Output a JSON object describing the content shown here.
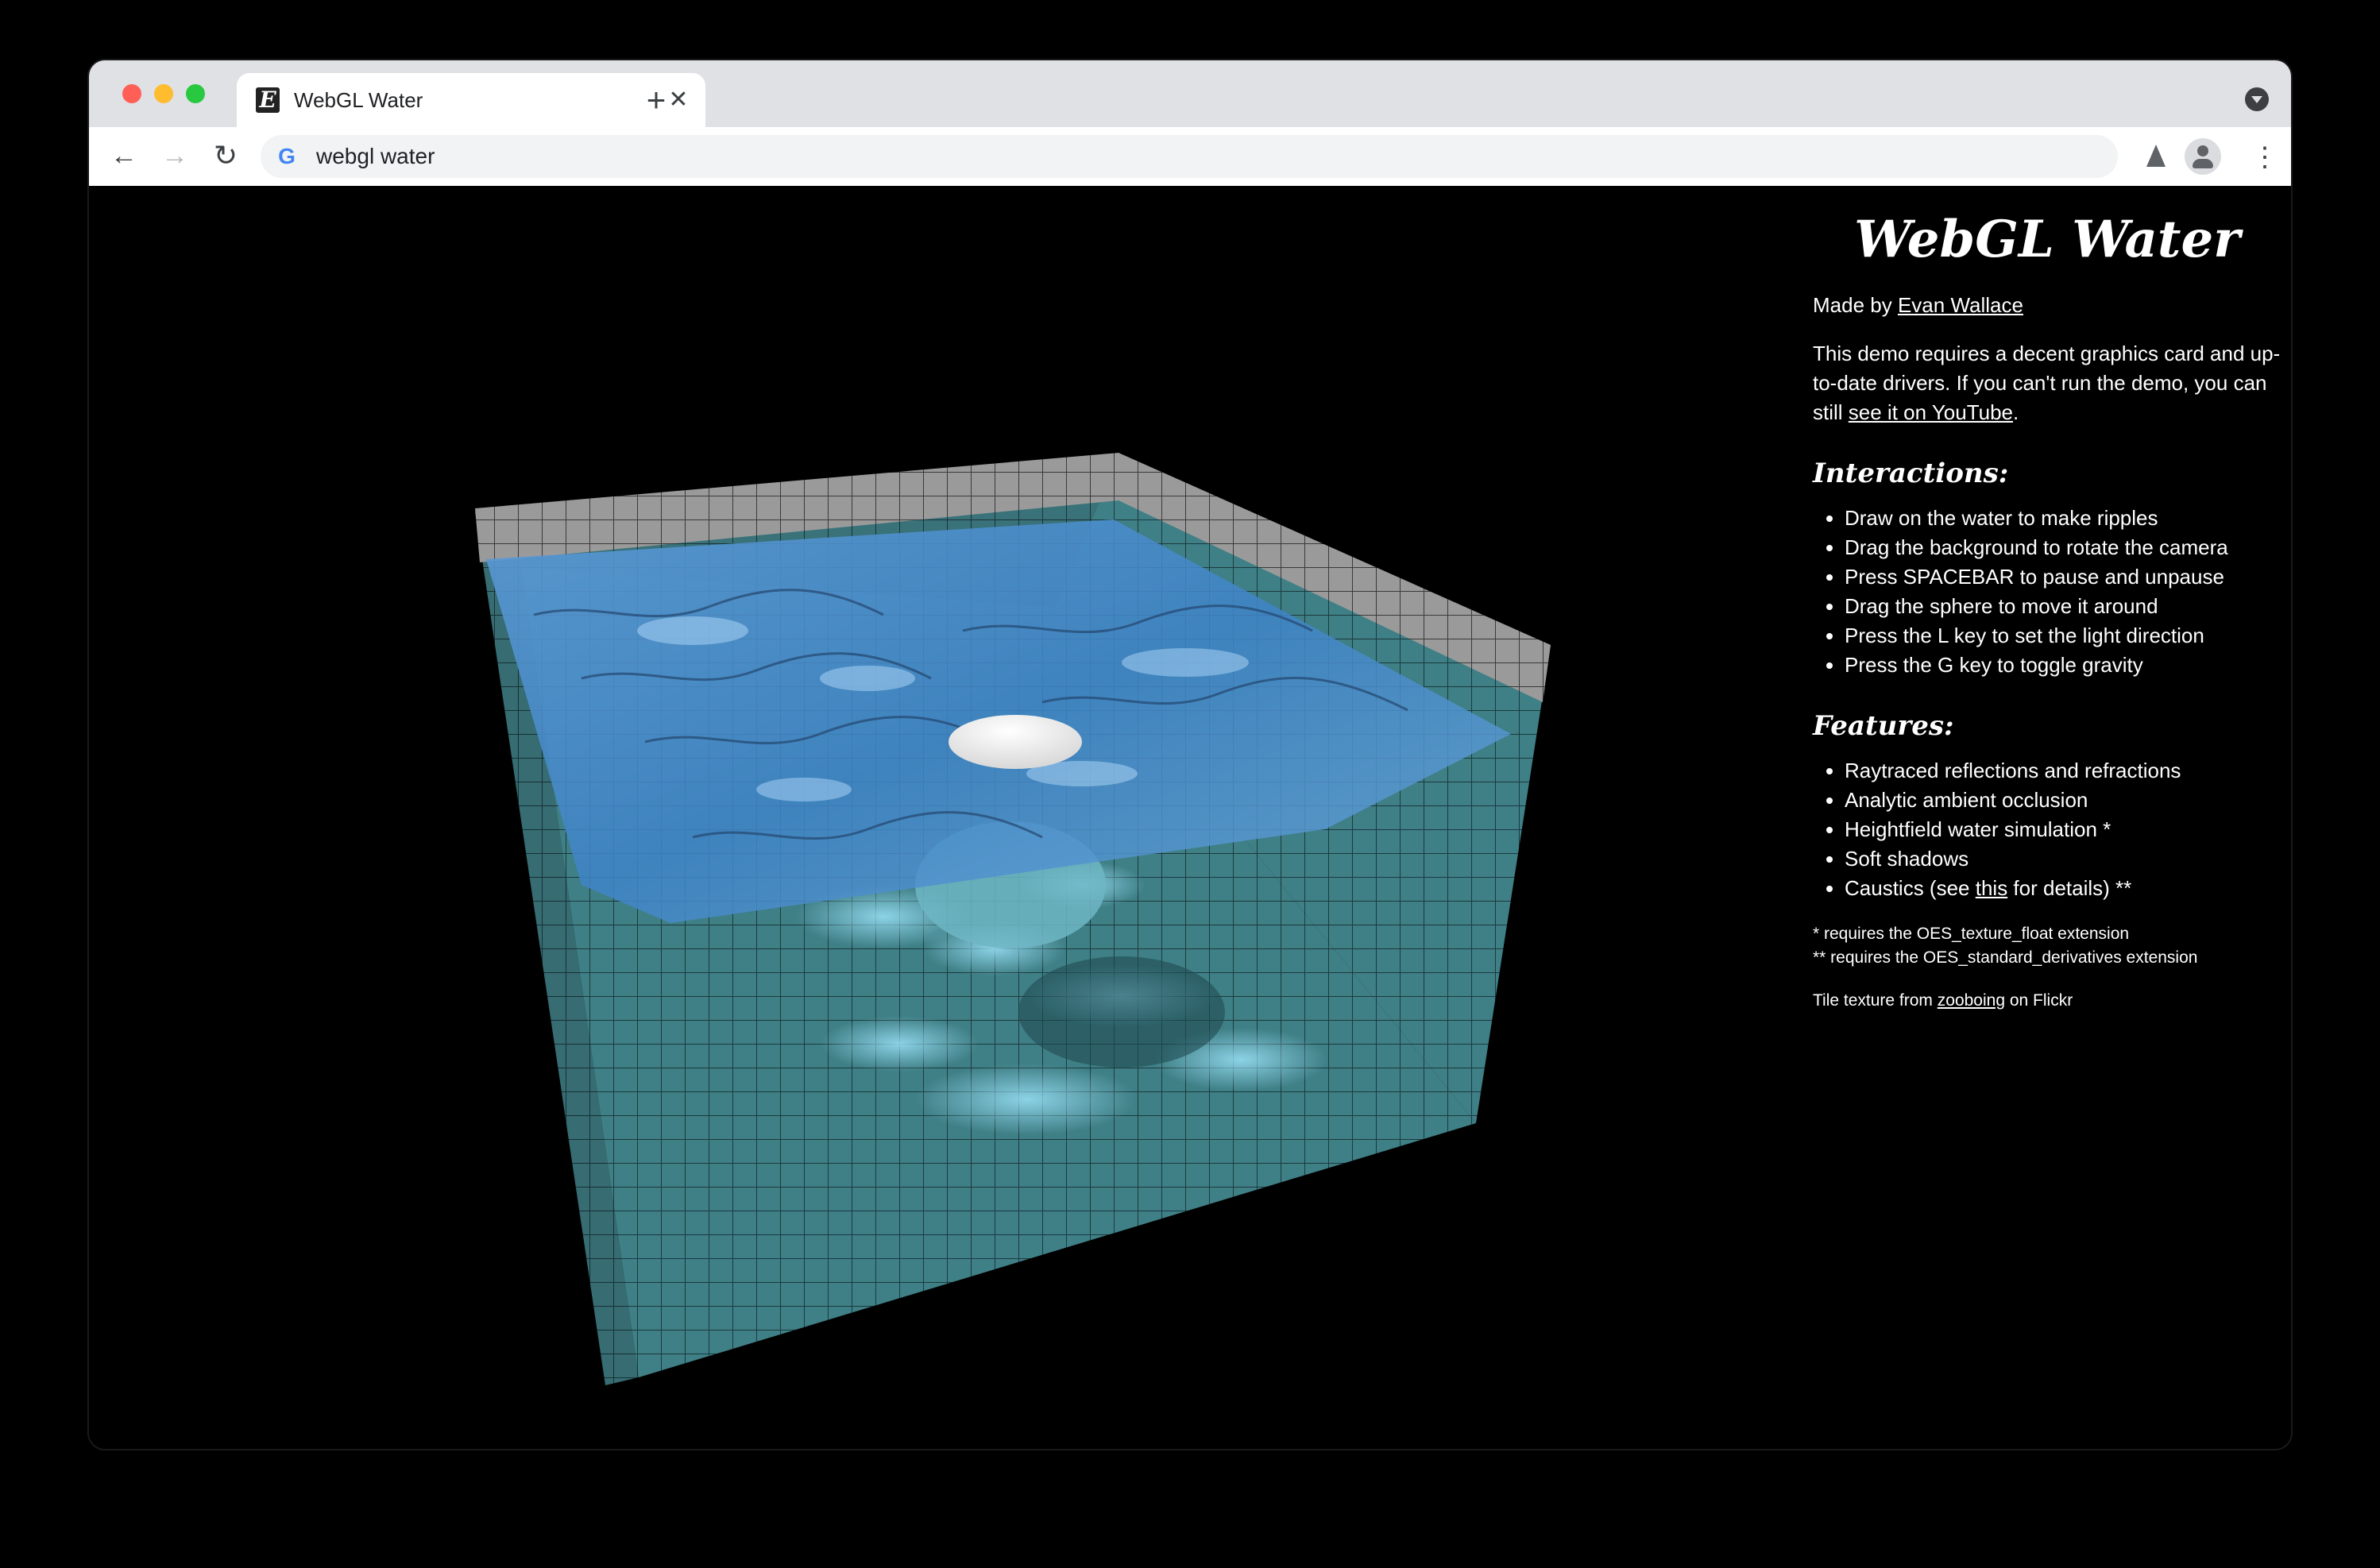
{
  "browser": {
    "tab_title": "WebGL Water",
    "favicon_letter": "E",
    "close_glyph": "✕",
    "new_tab_glyph": "+",
    "back_glyph": "←",
    "forward_glyph": "→",
    "reload_glyph": "↻",
    "menu_glyph": "⋮",
    "omnibox_text": "webgl water",
    "search_engine_glyph": "G"
  },
  "page": {
    "title": "WebGL Water",
    "made_by_prefix": "Made by ",
    "author_link": "Evan Wallace",
    "intro_text": "This demo requires a decent graphics card and up-to-date drivers. If you can't run the demo, you can still ",
    "youtube_link": "see it on YouTube",
    "intro_end": ".",
    "interactions_heading": "Interactions:",
    "interactions": [
      "Draw on the water to make ripples",
      "Drag the background to rotate the camera",
      "Press SPACEBAR to pause and unpause",
      "Drag the sphere to move it around",
      "Press the L key to set the light direction",
      "Press the G key to toggle gravity"
    ],
    "features_heading": "Features:",
    "features": [
      "Raytraced reflections and refractions",
      "Analytic ambient occlusion",
      "Heightfield water simulation *"
    ],
    "feature_soft_shadows": "Soft shadows",
    "caustics_prefix": "Caustics (see ",
    "caustics_link": "this",
    "caustics_suffix": " for details) **",
    "note1": "* requires the OES_texture_float extension",
    "note2": "** requires the OES_standard_derivatives extension",
    "credit_prefix": "Tile texture from ",
    "credit_link": "zooboing",
    "credit_suffix": " on Flickr"
  },
  "colors": {
    "tile_wall": "#3f7f86",
    "water": "#4d8fd0",
    "sphere": "#f2f2f2"
  }
}
